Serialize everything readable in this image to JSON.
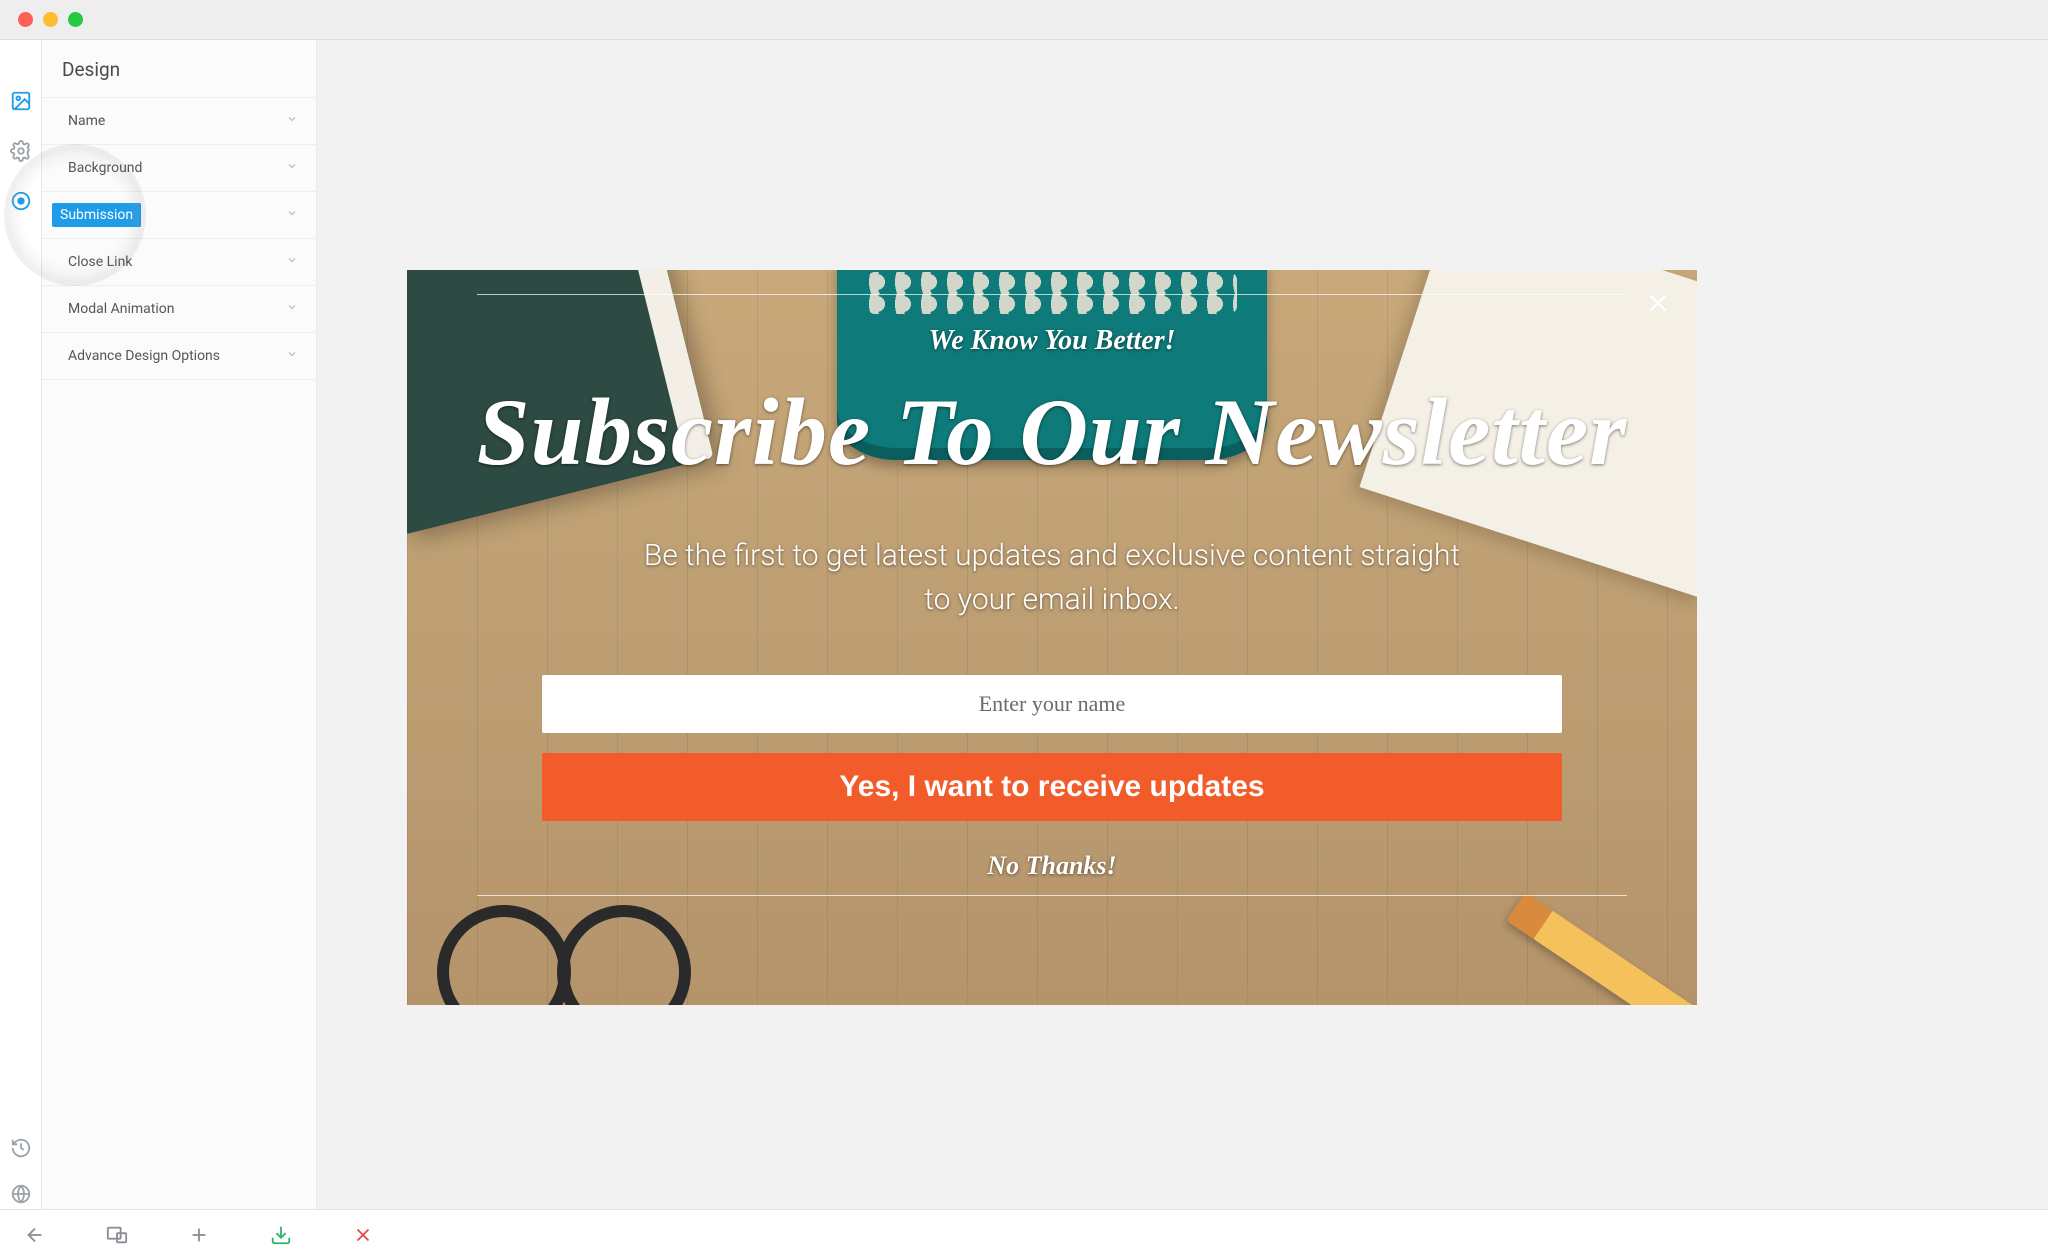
{
  "sidebar": {
    "title": "Design",
    "items": [
      {
        "label": "Name",
        "active": false
      },
      {
        "label": "Background",
        "active": false
      },
      {
        "label": "Submission",
        "active": true
      },
      {
        "label": "Close Link",
        "active": false
      },
      {
        "label": "Modal Animation",
        "active": false
      },
      {
        "label": "Advance Design Options",
        "active": false
      }
    ]
  },
  "modal": {
    "eyebrow": "We Know You Better!",
    "headline": "Subscribe To Our Newsletter",
    "subhead": "Be the first to get latest updates and exclusive content straight to your email inbox.",
    "name_placeholder": "Enter your name",
    "cta": "Yes, I want to receive updates",
    "decline": "No Thanks!"
  },
  "colors": {
    "accent": "#1e9cea",
    "cta": "#f25c2a"
  }
}
